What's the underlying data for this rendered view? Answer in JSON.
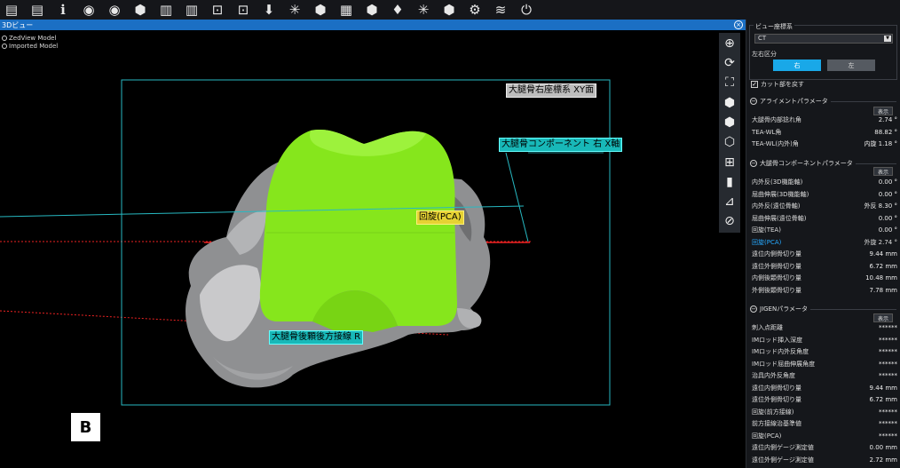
{
  "toolbar": {
    "icons": [
      "open-icon",
      "save-icon",
      "info-icon",
      "view-eye-icon",
      "view-eye-2-icon",
      "model-cube-icon",
      "chart-bars-icon",
      "chart-bars-2-icon",
      "screenshot-icon",
      "camera-settings-icon",
      "download-icon",
      "target-icon",
      "cube-alt-icon",
      "grid-icon",
      "cube-edit-icon",
      "lightbulb-icon",
      "axis-icon",
      "cube-check-icon",
      "gear-icon",
      "layers-icon",
      "power-icon"
    ],
    "glyphs": [
      "▤",
      "▤",
      "ℹ",
      "◉",
      "◉",
      "⬢",
      "▥",
      "▥",
      "⊡",
      "⊡",
      "⬇",
      "✳",
      "⬢",
      "▦",
      "⬢",
      "♦",
      "✳",
      "⬢",
      "⚙",
      "≋",
      "⏻"
    ]
  },
  "viewport": {
    "title": "3Dビュー",
    "models": [
      "ZedView Model",
      "Imported Model"
    ],
    "labels": {
      "coord_system": "大腿骨右座標系 XY面",
      "component_axis": "大腿骨コンポーネント 右 X軸",
      "rotation": "回旋(PCA)",
      "posterior_line": "大腿骨後顆後方接線 R"
    },
    "view_marker": "B"
  },
  "side_tools": {
    "icons": [
      "zoom-in-icon",
      "rotate-icon",
      "fit-view-icon",
      "cube-view-icon",
      "cube-solid-icon",
      "cube-wire-icon",
      "hierarchy-icon",
      "ruler-icon",
      "measure-angle-icon",
      "cancel-icon"
    ],
    "glyphs": [
      "⊕",
      "⟳",
      "⛶",
      "⬢",
      "⬢",
      "⬡",
      "⊞",
      "▮",
      "⊿",
      "⊘"
    ]
  },
  "panel": {
    "coord_label": "ビュー座標系",
    "coord_value": "CT",
    "side_label": "左右区分",
    "right_btn": "右",
    "left_btn": "左",
    "cut_check": "カット部を戻す",
    "show_label": "表示",
    "alignment": {
      "title": "アライメントパラメータ",
      "rows": [
        {
          "k": "大腿骨内部捻れ角",
          "v": "2.74 °"
        },
        {
          "k": "TEA-WL角",
          "v": "88.82 °"
        },
        {
          "k": "TEA-WL(内外)角",
          "v": "内旋 1.18 °"
        }
      ]
    },
    "component": {
      "title": "大腿骨コンポーネントパラメータ",
      "rows": [
        {
          "k": "内外反(3D機能軸)",
          "v": "0.00 °"
        },
        {
          "k": "屈曲伸展(3D機能軸)",
          "v": "0.00 °"
        },
        {
          "k": "内外反(遠位骨軸)",
          "v": "外反 8.30 °"
        },
        {
          "k": "屈曲伸展(遠位骨軸)",
          "v": "0.00 °"
        },
        {
          "k": "回旋(TEA)",
          "v": "0.00 °"
        },
        {
          "k": "回旋(PCA)",
          "v": "外旋 2.74 °",
          "hl": true
        },
        {
          "k": "遠位内側骨切り量",
          "v": "9.44 mm"
        },
        {
          "k": "遠位外側骨切り量",
          "v": "6.72 mm"
        },
        {
          "k": "内側後顆骨切り量",
          "v": "10.48 mm"
        },
        {
          "k": "外側後顆骨切り量",
          "v": "7.78 mm"
        }
      ]
    },
    "jigen": {
      "title": "JIGENパラメータ",
      "rows": [
        {
          "k": "刺入点距離",
          "v": "******"
        },
        {
          "k": "IMロッド挿入深度",
          "v": "******"
        },
        {
          "k": "IMロッド内外反角度",
          "v": "******"
        },
        {
          "k": "IMロッド屈曲伸展角度",
          "v": "******"
        },
        {
          "k": "治具内外反角度",
          "v": "******"
        },
        {
          "k": "遠位内側骨切り量",
          "v": "9.44 mm"
        },
        {
          "k": "遠位外側骨切り量",
          "v": "6.72 mm"
        },
        {
          "k": "回旋(前方接線)",
          "v": "******"
        },
        {
          "k": "前方接線治基準値",
          "v": "******"
        },
        {
          "k": "回旋(PCA)",
          "v": "******"
        },
        {
          "k": "遠位内側ゲージ測定値",
          "v": "0.00 mm"
        },
        {
          "k": "遠位外側ゲージ測定値",
          "v": "2.72 mm"
        }
      ]
    }
  }
}
